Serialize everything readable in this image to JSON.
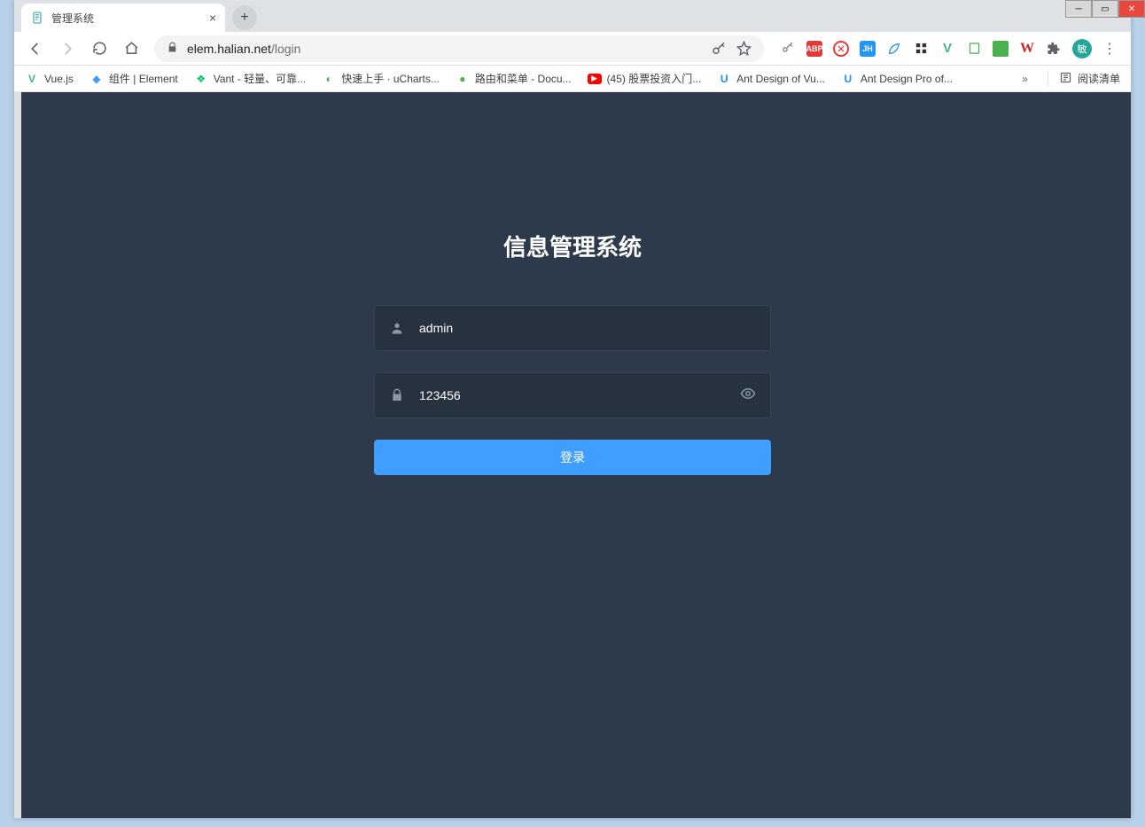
{
  "window": {
    "tab_title": "管理系统",
    "url_host": "elem.halian.net",
    "url_path": "/login"
  },
  "bookmarks": {
    "items": [
      {
        "label": "Vue.js",
        "icon": "V",
        "color": "#41b883"
      },
      {
        "label": "组件 | Element",
        "icon": "◆",
        "color": "#409eff"
      },
      {
        "label": "Vant - 轻量、可靠...",
        "icon": "⬡",
        "color": "#07c160"
      },
      {
        "label": "快速上手 · uCharts...",
        "icon": "◐",
        "color": "#4caf50"
      },
      {
        "label": "路由和菜单 - Docu...",
        "icon": "●",
        "color": "#4caf50"
      },
      {
        "label": "(45) 股票投资入门...",
        "icon": "▶",
        "color": "#ff0000"
      },
      {
        "label": "Ant Design of Vu...",
        "icon": "U",
        "color": "#1890ff"
      },
      {
        "label": "Ant Design Pro of...",
        "icon": "U",
        "color": "#1890ff"
      }
    ],
    "overflow": "»",
    "reading_list": "阅读清单"
  },
  "login": {
    "title": "信息管理系统",
    "username_value": "admin",
    "password_value": "123456",
    "button_label": "登录"
  },
  "profile": {
    "avatar_text": "敏"
  }
}
